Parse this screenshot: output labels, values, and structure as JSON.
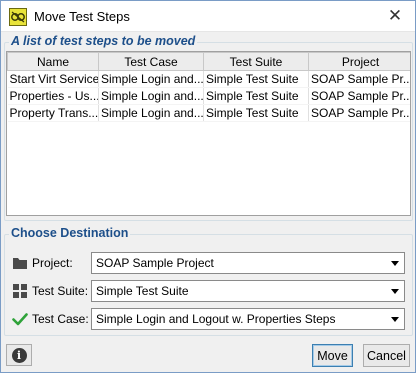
{
  "window": {
    "title": "Move Test Steps",
    "close_glyph": "✕"
  },
  "steps_group": {
    "title": "A list of test steps to be moved",
    "columns": [
      "Name",
      "Test Case",
      "Test Suite",
      "Project"
    ],
    "rows": [
      [
        "Start Virt Service",
        "Simple Login and...",
        "Simple Test Suite",
        "SOAP Sample Pr..."
      ],
      [
        "Properties - Us...",
        "Simple Login and...",
        "Simple Test Suite",
        "SOAP Sample Pr..."
      ],
      [
        "Property Trans...",
        "Simple Login and...",
        "Simple Test Suite",
        "SOAP Sample Pr..."
      ]
    ]
  },
  "destination_group": {
    "title": "Choose Destination",
    "project": {
      "label": "Project:",
      "value": "SOAP Sample Project",
      "icon": "folder-icon"
    },
    "test_suite": {
      "label": "Test Suite:",
      "value": "Simple Test Suite",
      "icon": "grid-icon"
    },
    "test_case": {
      "label": "Test Case:",
      "value": "Simple Login and Logout w. Properties Steps",
      "icon": "checkmark-icon"
    }
  },
  "buttons": {
    "info_glyph": "i",
    "move": "Move",
    "cancel": "Cancel"
  },
  "colors": {
    "group_title": "#1d4f8a",
    "check": "#2fa33a",
    "default_button_border": "#3c7fb1"
  }
}
